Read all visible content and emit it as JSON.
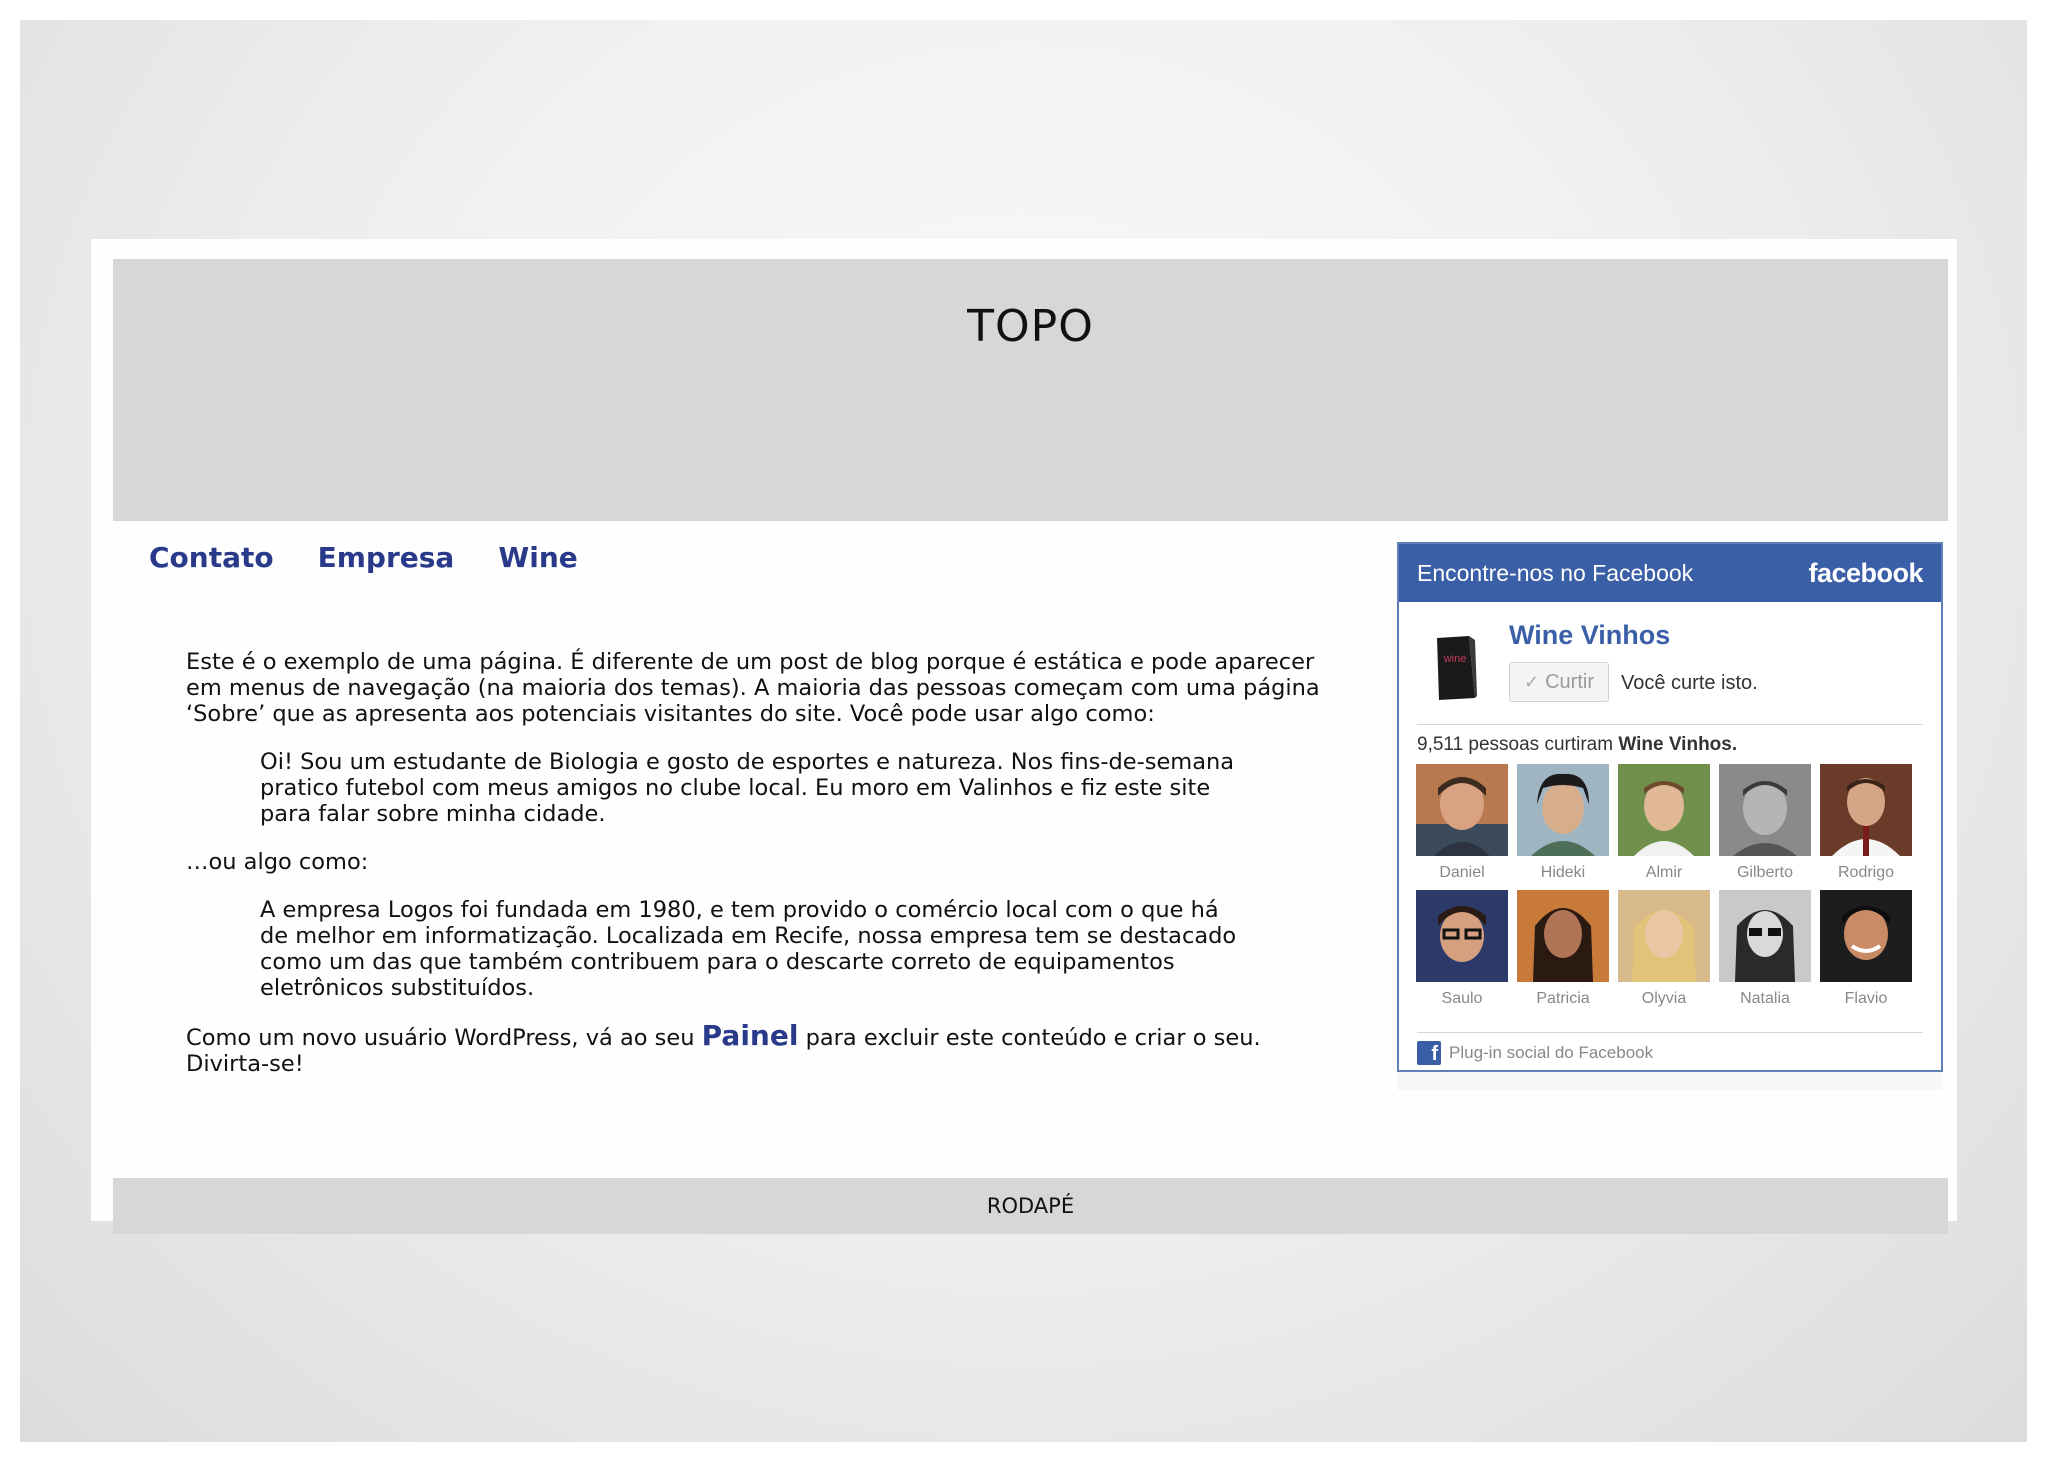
{
  "header": {
    "title": "TOPO"
  },
  "nav": {
    "items": [
      "Contato",
      "Empresa",
      "Wine"
    ]
  },
  "content": {
    "intro": "Este é o exemplo de uma página. É diferente de um post de blog porque é estática e pode aparecer em menus de navegação (na maioria dos temas). A maioria das pessoas começam com uma página ‘Sobre’ que as apresenta aos potenciais visitantes do site. Você pode usar algo como:",
    "quote1": "Oi! Sou um estudante de Biologia e gosto de esportes e natureza. Nos fins-de-semana pratico futebol com meus amigos no clube local. Eu moro em Valinhos e fiz este site para falar sobre minha cidade.",
    "alt": "…ou algo como:",
    "quote2": "A empresa Logos foi fundada em 1980, e tem provido o comércio local com o que há de melhor em informatização. Localizada em Recife, nossa empresa tem se destacado como um das que também contribuem para o descarte correto de equipamentos eletrônicos substituídos.",
    "outro_before": "Como um novo usuário WordPress, vá ao seu ",
    "painel_link": "Painel",
    "outro_after": " para excluir este conteúdo e criar o seu. Divirta-se!"
  },
  "footer": {
    "label": "RODAPÉ"
  },
  "facebook": {
    "header_title": "Encontre-nos no Facebook",
    "logo": "facebook",
    "page_name": "Wine Vinhos",
    "like_icon": "check-icon",
    "like_label": "Curtir",
    "liked_text": "Você curte isto.",
    "count_text": "9,511 pessoas curtiram ",
    "count_page": "Wine Vinhos.",
    "faces": [
      "Daniel",
      "Hideki",
      "Almir",
      "Gilberto",
      "Rodrigo",
      "Saulo",
      "Patricia",
      "Olyvia",
      "Natalia",
      "Flavio"
    ],
    "footer_label": "Plug-in social do Facebook",
    "thumb_text": "wine",
    "colors": {
      "brand": "#3b5fa7",
      "nav_link": "#2a3a8a",
      "band": "#d7d7d9"
    }
  }
}
